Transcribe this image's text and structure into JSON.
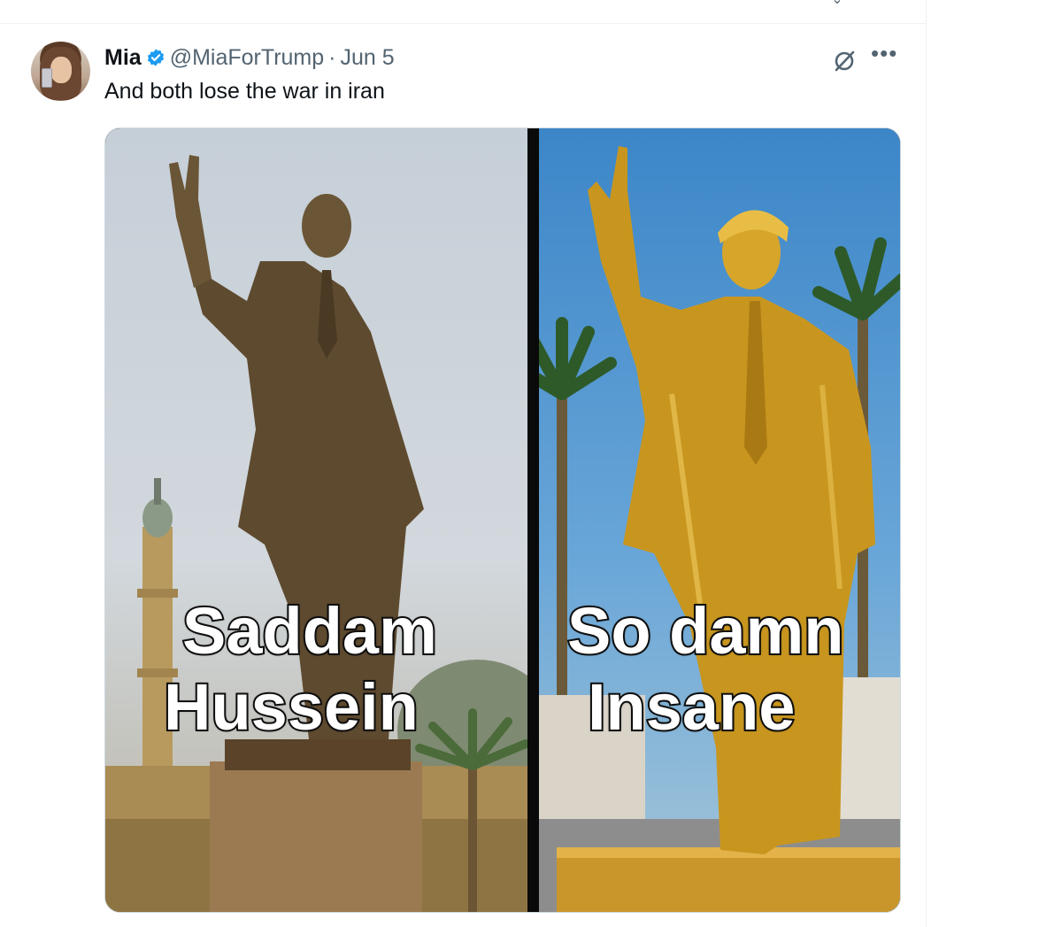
{
  "post": {
    "author_name": "Mia",
    "author_handle": "@MiaForTrump",
    "separator": "·",
    "date": "Jun 5",
    "text": "And both lose the war in iran"
  },
  "media": {
    "left_caption_line1": "Saddam",
    "left_caption_line2": "Hussein",
    "right_caption_line1": "So damn",
    "right_caption_line2": "Insane"
  },
  "icons": {
    "verified": "verified-badge-icon",
    "grok": "grok-icon",
    "more": "more-icon"
  },
  "colors": {
    "verified_blue": "#1d9bf0",
    "secondary_text": "#536471",
    "primary_text": "#0f1419"
  }
}
